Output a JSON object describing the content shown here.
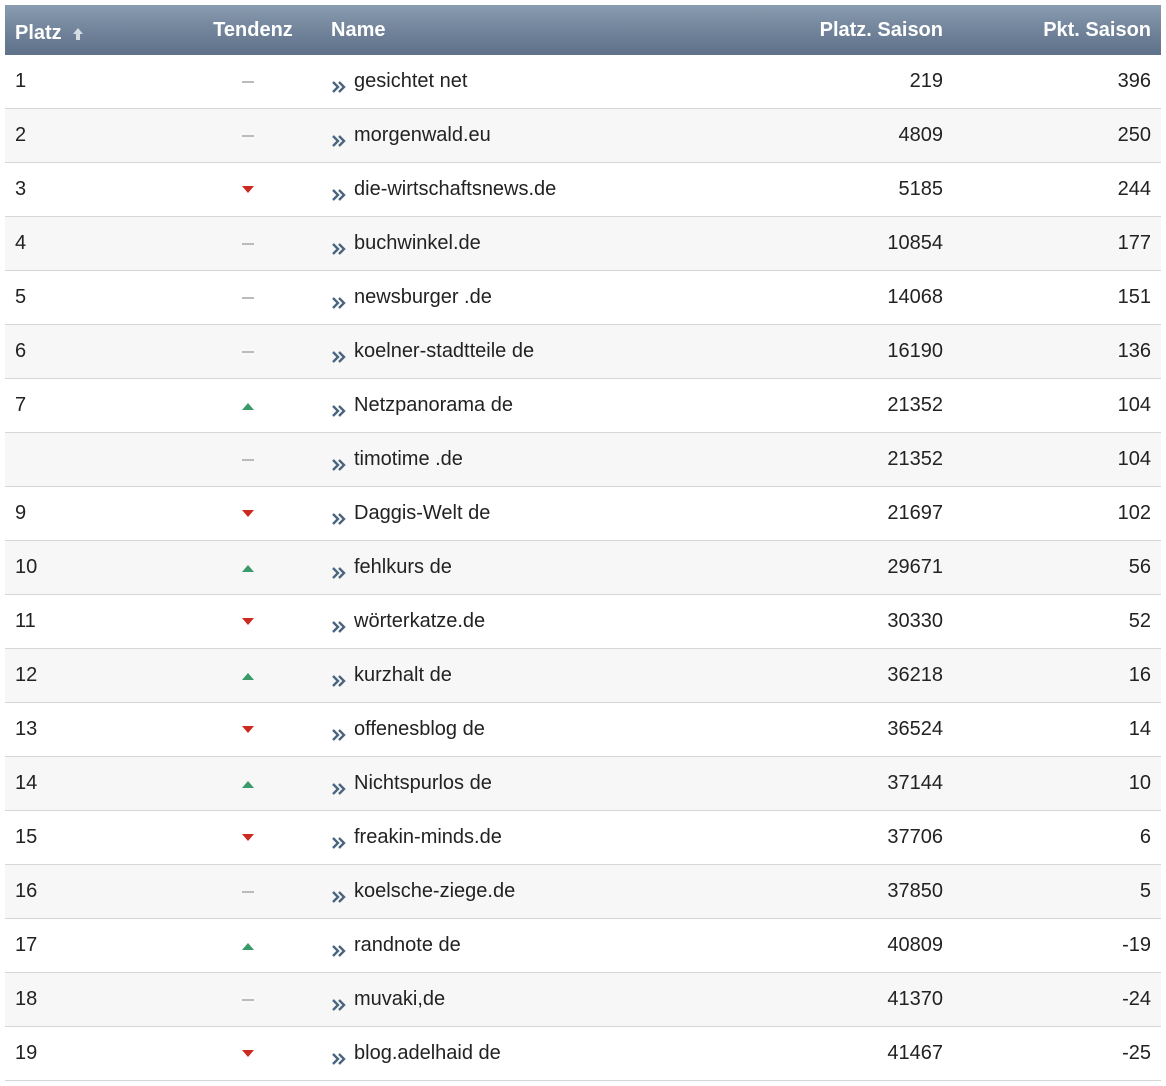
{
  "table": {
    "headers": {
      "platz": "Platz",
      "tendenz": "Tendenz",
      "name": "Name",
      "platz_saison": "Platz. Saison",
      "pkt_saison": "Pkt. Saison"
    },
    "sort_icon": "sort-ascending-icon",
    "colors": {
      "header_bg": "#6f8299",
      "up": "#3a9a6a",
      "down": "#cc2a1e",
      "same": "#bbbbbb",
      "arrow": "#4a6580"
    },
    "rows": [
      {
        "platz": "1",
        "trend": "same",
        "name": "gesichtet net",
        "platz_saison": "219",
        "pkt_saison": "396"
      },
      {
        "platz": "2",
        "trend": "same",
        "name": "morgenwald.eu",
        "platz_saison": "4809",
        "pkt_saison": "250"
      },
      {
        "platz": "3",
        "trend": "down",
        "name": "die-wirtschaftsnews.de",
        "platz_saison": "5185",
        "pkt_saison": "244"
      },
      {
        "platz": "4",
        "trend": "same",
        "name": "buchwinkel.de",
        "platz_saison": "10854",
        "pkt_saison": "177"
      },
      {
        "platz": "5",
        "trend": "same",
        "name": "newsburger .de",
        "platz_saison": "14068",
        "pkt_saison": "151"
      },
      {
        "platz": "6",
        "trend": "same",
        "name": "koelner-stadtteile de",
        "platz_saison": "16190",
        "pkt_saison": "136"
      },
      {
        "platz": "7",
        "trend": "up",
        "name": "Netzpanorama de",
        "platz_saison": "21352",
        "pkt_saison": "104"
      },
      {
        "platz": "",
        "trend": "same",
        "name": "timotime .de",
        "platz_saison": "21352",
        "pkt_saison": "104"
      },
      {
        "platz": "9",
        "trend": "down",
        "name": "Daggis-Welt de",
        "platz_saison": "21697",
        "pkt_saison": "102"
      },
      {
        "platz": "10",
        "trend": "up",
        "name": "fehlkurs de",
        "platz_saison": "29671",
        "pkt_saison": "56"
      },
      {
        "platz": "11",
        "trend": "down",
        "name": "wörterkatze.de",
        "platz_saison": "30330",
        "pkt_saison": "52"
      },
      {
        "platz": "12",
        "trend": "up",
        "name": "kurzhalt de",
        "platz_saison": "36218",
        "pkt_saison": "16"
      },
      {
        "platz": "13",
        "trend": "down",
        "name": "offenesblog de",
        "platz_saison": "36524",
        "pkt_saison": "14"
      },
      {
        "platz": "14",
        "trend": "up",
        "name": "Nichtspurlos de",
        "platz_saison": "37144",
        "pkt_saison": "10"
      },
      {
        "platz": "15",
        "trend": "down",
        "name": "freakin-minds.de",
        "platz_saison": "37706",
        "pkt_saison": "6"
      },
      {
        "platz": "16",
        "trend": "same",
        "name": "koelsche-ziege.de",
        "platz_saison": "37850",
        "pkt_saison": "5"
      },
      {
        "platz": "17",
        "trend": "up",
        "name": "randnote de",
        "platz_saison": "40809",
        "pkt_saison": "-19"
      },
      {
        "platz": "18",
        "trend": "same",
        "name": "muvaki,de",
        "platz_saison": "41370",
        "pkt_saison": "-24"
      },
      {
        "platz": "19",
        "trend": "down",
        "name": "blog.adelhaid de",
        "platz_saison": "41467",
        "pkt_saison": "-25"
      }
    ]
  }
}
